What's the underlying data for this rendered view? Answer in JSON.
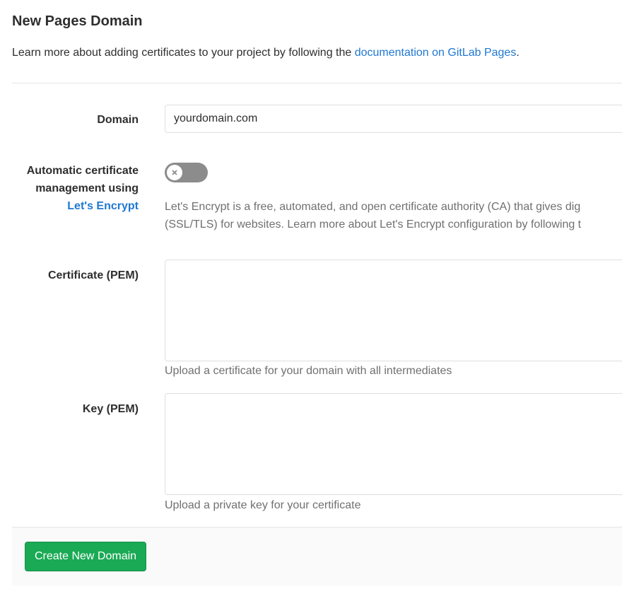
{
  "page": {
    "title": "New Pages Domain",
    "intro_text": "Learn more about adding certificates to your project by following the ",
    "intro_link": "documentation on GitLab Pages",
    "intro_end": "."
  },
  "form": {
    "domain": {
      "label": "Domain",
      "value": "yourdomain.com"
    },
    "auto_cert": {
      "label_line1": "Automatic certificate",
      "label_line2": "management using",
      "label_link": "Let's Encrypt",
      "toggle_state": "off",
      "help_line1": "Let's Encrypt is a free, automated, and open certificate authority (CA) that gives dig",
      "help_line2": "(SSL/TLS) for websites. Learn more about Let's Encrypt configuration by following t"
    },
    "certificate": {
      "label": "Certificate (PEM)",
      "value": "",
      "help": "Upload a certificate for your domain with all intermediates"
    },
    "key": {
      "label": "Key (PEM)",
      "value": "",
      "help": "Upload a private key for your certificate"
    }
  },
  "footer": {
    "create_label": "Create New Domain"
  },
  "colors": {
    "link": "#1f78d1",
    "toggle_off": "#8c8c8c",
    "button_green": "#1aaa55"
  },
  "icons": {
    "toggle_knob": "close-icon"
  }
}
